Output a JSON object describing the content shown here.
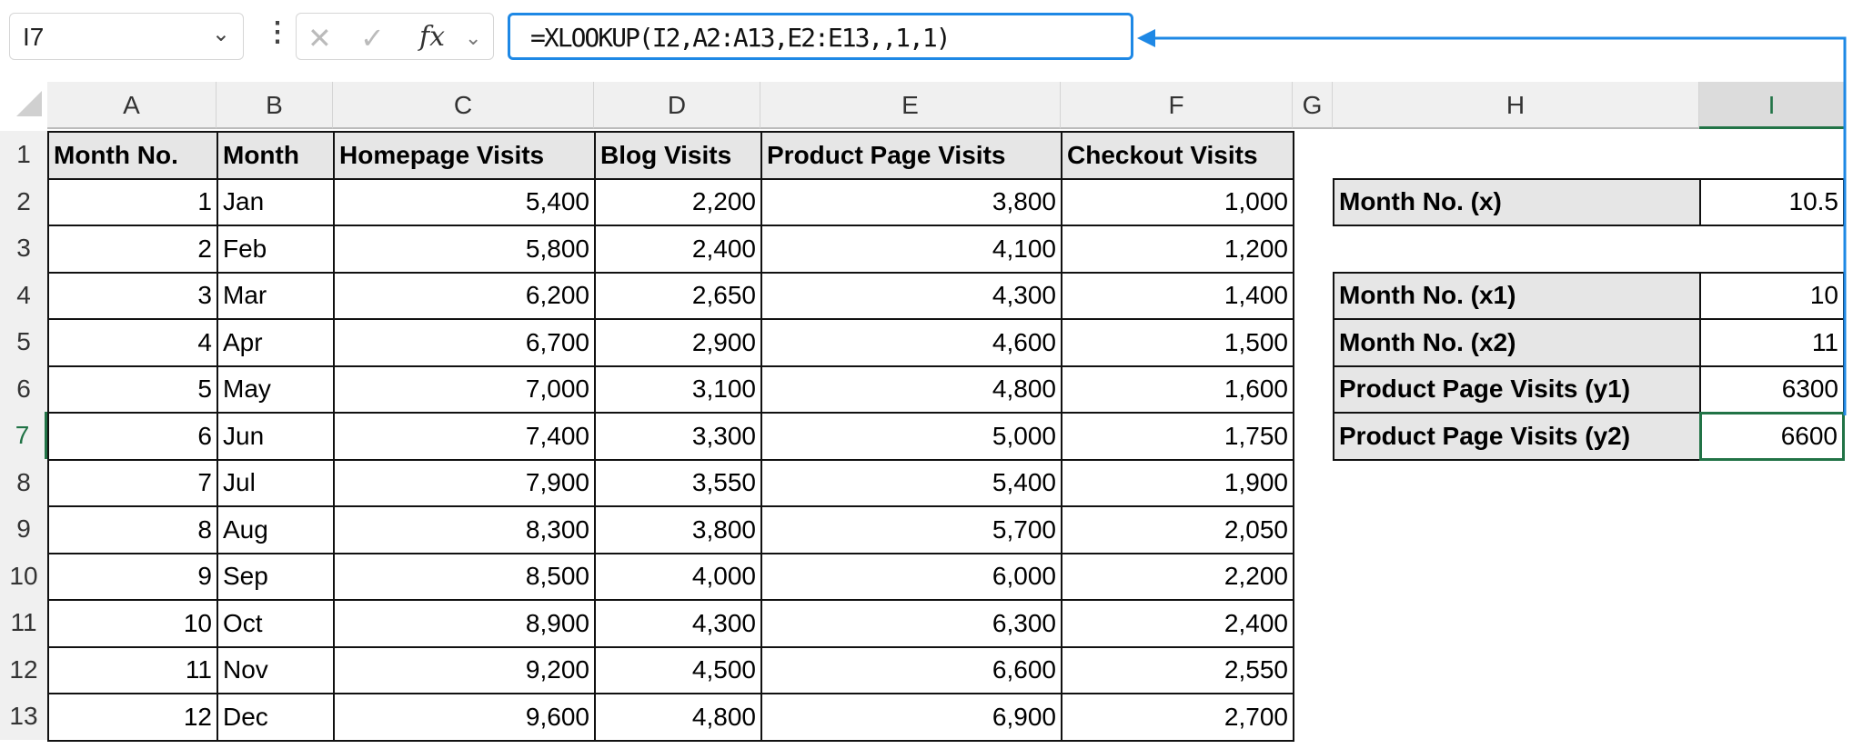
{
  "name_box": {
    "value": "I7"
  },
  "formula_bar": {
    "cancel_icon": "✕",
    "enter_icon": "✓",
    "fx_label": "fx",
    "formula": "=XLOOKUP(I2,A2:A13,E2:E13,,1,1)"
  },
  "columns": [
    "A",
    "B",
    "C",
    "D",
    "E",
    "F",
    "G",
    "H",
    "I"
  ],
  "rows": [
    "1",
    "2",
    "3",
    "4",
    "5",
    "6",
    "7",
    "8",
    "9",
    "10",
    "11",
    "12",
    "13"
  ],
  "table": {
    "headers": [
      "Month No.",
      "Month",
      "Homepage Visits",
      "Blog Visits",
      "Product Page Visits",
      "Checkout Visits"
    ],
    "data": [
      [
        "1",
        "Jan",
        "5,400",
        "2,200",
        "3,800",
        "1,000"
      ],
      [
        "2",
        "Feb",
        "5,800",
        "2,400",
        "4,100",
        "1,200"
      ],
      [
        "3",
        "Mar",
        "6,200",
        "2,650",
        "4,300",
        "1,400"
      ],
      [
        "4",
        "Apr",
        "6,700",
        "2,900",
        "4,600",
        "1,500"
      ],
      [
        "5",
        "May",
        "7,000",
        "3,100",
        "4,800",
        "1,600"
      ],
      [
        "6",
        "Jun",
        "7,400",
        "3,300",
        "5,000",
        "1,750"
      ],
      [
        "7",
        "Jul",
        "7,900",
        "3,550",
        "5,400",
        "1,900"
      ],
      [
        "8",
        "Aug",
        "8,300",
        "3,800",
        "5,700",
        "2,050"
      ],
      [
        "9",
        "Sep",
        "8,500",
        "4,000",
        "6,000",
        "2,200"
      ],
      [
        "10",
        "Oct",
        "8,900",
        "4,300",
        "6,300",
        "2,400"
      ],
      [
        "11",
        "Nov",
        "9,200",
        "4,500",
        "6,600",
        "2,550"
      ],
      [
        "12",
        "Dec",
        "9,600",
        "4,800",
        "6,900",
        "2,700"
      ]
    ]
  },
  "side_table": [
    {
      "row": 2,
      "label": "Month No. (x)",
      "value": "10.5"
    },
    {
      "row": 4,
      "label": "Month No. (x1)",
      "value": "10"
    },
    {
      "row": 5,
      "label": "Month No. (x2)",
      "value": "11"
    },
    {
      "row": 6,
      "label": "Product Page Visits (y1)",
      "value": "6300"
    },
    {
      "row": 7,
      "label": "Product Page Visits (y2)",
      "value": "6600"
    }
  ],
  "selected": {
    "column": "I",
    "row": "7"
  },
  "colors": {
    "accent": "#1e88e5",
    "excel_green": "#217346"
  }
}
